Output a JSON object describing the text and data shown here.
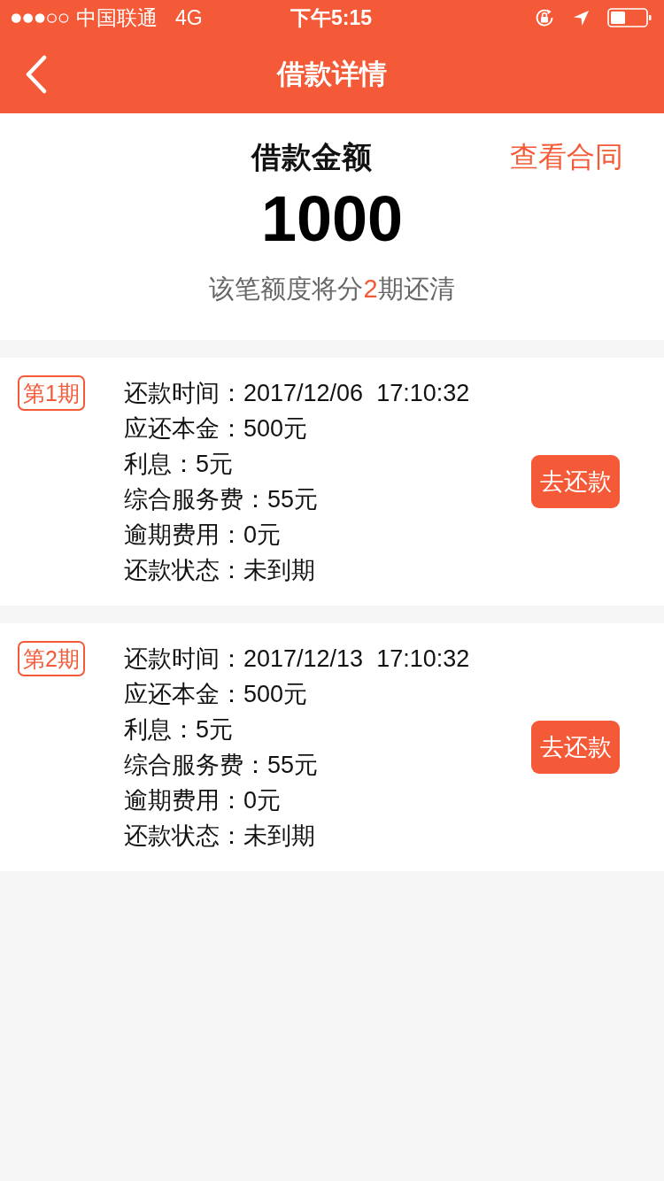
{
  "status_bar": {
    "carrier": "中国联通",
    "network": "4G",
    "time": "下午5:15"
  },
  "nav_bar": {
    "title": "借款详情"
  },
  "summary": {
    "label": "借款金额",
    "contract_link": "查看合同",
    "amount": "1000",
    "plan_text": {
      "before": "该笔额度将分",
      "count": "2",
      "after": "期还清"
    }
  },
  "installments": [
    {
      "badge": "第1期",
      "fields": [
        {
          "label": "还款时间：",
          "value": "2017/12/06  17:10:32"
        },
        {
          "label": "应还本金：",
          "value": "500元"
        },
        {
          "label": "利息：",
          "value": "5元"
        },
        {
          "label": "综合服务费：",
          "value": "55元"
        },
        {
          "label": "逾期费用：",
          "value": "0元"
        },
        {
          "label": "还款状态：",
          "value": "未到期"
        }
      ],
      "button": "去还款"
    },
    {
      "badge": "第2期",
      "fields": [
        {
          "label": "还款时间：",
          "value": "2017/12/13  17:10:32"
        },
        {
          "label": "应还本金：",
          "value": "500元"
        },
        {
          "label": "利息：",
          "value": "5元"
        },
        {
          "label": "综合服务费：",
          "value": "55元"
        },
        {
          "label": "逾期费用：",
          "value": "0元"
        },
        {
          "label": "还款状态：",
          "value": "未到期"
        }
      ],
      "button": "去还款"
    }
  ]
}
